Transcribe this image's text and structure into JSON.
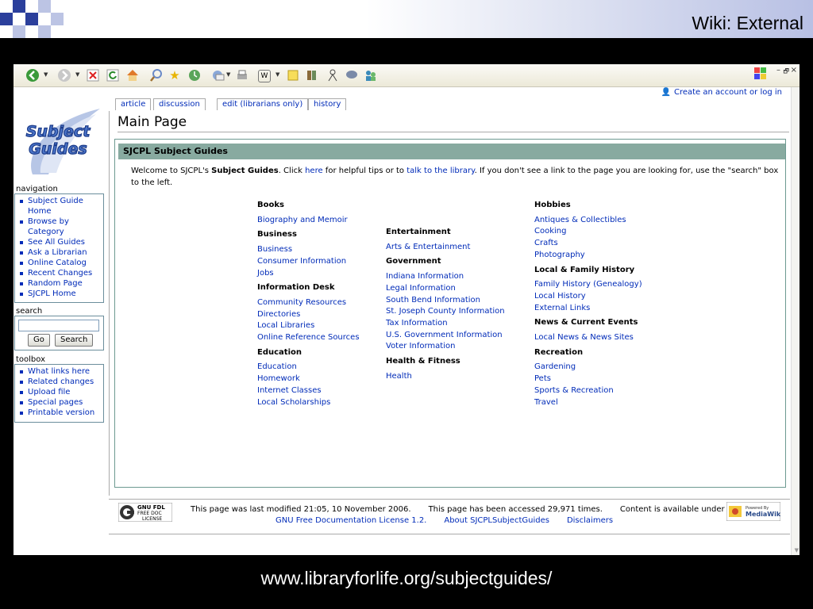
{
  "slide": {
    "title": "Wiki: External",
    "url": "www.libraryforlife.org/subjectguides/"
  },
  "colors": {
    "link": "#002bb8",
    "box_header": "#88aaa0",
    "box_border": "#6d9a91",
    "slide_blue": "#2b3f9c"
  },
  "toolbar": {
    "icons": [
      "back-icon",
      "forward-icon",
      "stop-icon",
      "refresh-icon",
      "home-icon",
      "search-icon",
      "favorites-icon",
      "history-icon",
      "mail-icon",
      "print-icon",
      "word-icon",
      "notes-icon",
      "research-icon",
      "messenger-icon",
      "discuss-icon",
      "people-icon"
    ],
    "window_controls": [
      "–",
      "🗗",
      "×"
    ]
  },
  "personal": {
    "create_account": "Create an account or log in"
  },
  "tabs": [
    "article",
    "discussion",
    "edit (librarians only)",
    "history"
  ],
  "logo": {
    "line1": "Subject",
    "line2": "Guides"
  },
  "sidebar": {
    "navigation": {
      "title": "navigation",
      "items": [
        "Subject Guide Home",
        "Browse by Category",
        "See All Guides",
        "Ask a Librarian",
        "Online Catalog",
        "Recent Changes",
        "Random Page",
        "SJCPL Home"
      ]
    },
    "search": {
      "title": "search",
      "go": "Go",
      "search": "Search"
    },
    "toolbox": {
      "title": "toolbox",
      "items": [
        "What links here",
        "Related changes",
        "Upload file",
        "Special pages",
        "Printable version"
      ]
    }
  },
  "article": {
    "title": "Main Page",
    "box_title": "SJCPL Subject Guides",
    "intro": {
      "p1": "Welcome to SJCPL's ",
      "bold": "Subject Guides",
      "p2": ". Click ",
      "link1": "here",
      "p3": " for helpful tips or to ",
      "link2": "talk to the library",
      "p4": ". If you don't see a link to the page you are looking for, use the \"search\" box to the left."
    },
    "col1": [
      {
        "heading": "Books",
        "links": [
          "Biography and Memoir"
        ]
      },
      {
        "heading": "Business",
        "links": [
          "Business",
          "Consumer Information",
          "Jobs"
        ]
      },
      {
        "heading": "Information Desk",
        "links": [
          "Community Resources",
          "Directories",
          "Local Libraries",
          "Online Reference Sources"
        ]
      },
      {
        "heading": "Education",
        "links": [
          "Education",
          "Homework",
          "Internet Classes",
          "Local Scholarships"
        ]
      }
    ],
    "col2": [
      {
        "heading": "Entertainment",
        "links": [
          "Arts & Entertainment"
        ]
      },
      {
        "heading": "Government",
        "links": [
          "Indiana Information",
          "Legal Information",
          "South Bend Information",
          "St. Joseph County Information",
          "Tax Information",
          "U.S. Government Information",
          "Voter Information"
        ]
      },
      {
        "heading": "Health & Fitness",
        "links": [
          "Health"
        ]
      }
    ],
    "col3": [
      {
        "heading": "Hobbies",
        "links": [
          "Antiques & Collectibles",
          "Cooking",
          "Crafts",
          "Photography"
        ]
      },
      {
        "heading": "Local & Family History",
        "links": [
          "Family History (Genealogy)",
          "Local History",
          "External Links"
        ]
      },
      {
        "heading": "News & Current Events",
        "links": [
          "Local News & News Sites"
        ]
      },
      {
        "heading": "Recreation",
        "links": [
          "Gardening",
          "Pets",
          "Sports & Recreation",
          "Travel"
        ]
      }
    ]
  },
  "footer": {
    "gnu_line1": "GNU FDL",
    "gnu_line2": "FREE DOC",
    "gnu_line3": "LICENSE",
    "modified": "This page was last modified 21:05, 10 November 2006.",
    "accessed": "This page has been accessed 29,971 times.",
    "available": "Content is available under",
    "license_link": "GNU Free Documentation License 1.2.",
    "about_link": "About SJCPLSubjectGuides",
    "disclaimers_link": "Disclaimers",
    "mw_line1": "Powered By",
    "mw_line2": "MediaWiki"
  }
}
